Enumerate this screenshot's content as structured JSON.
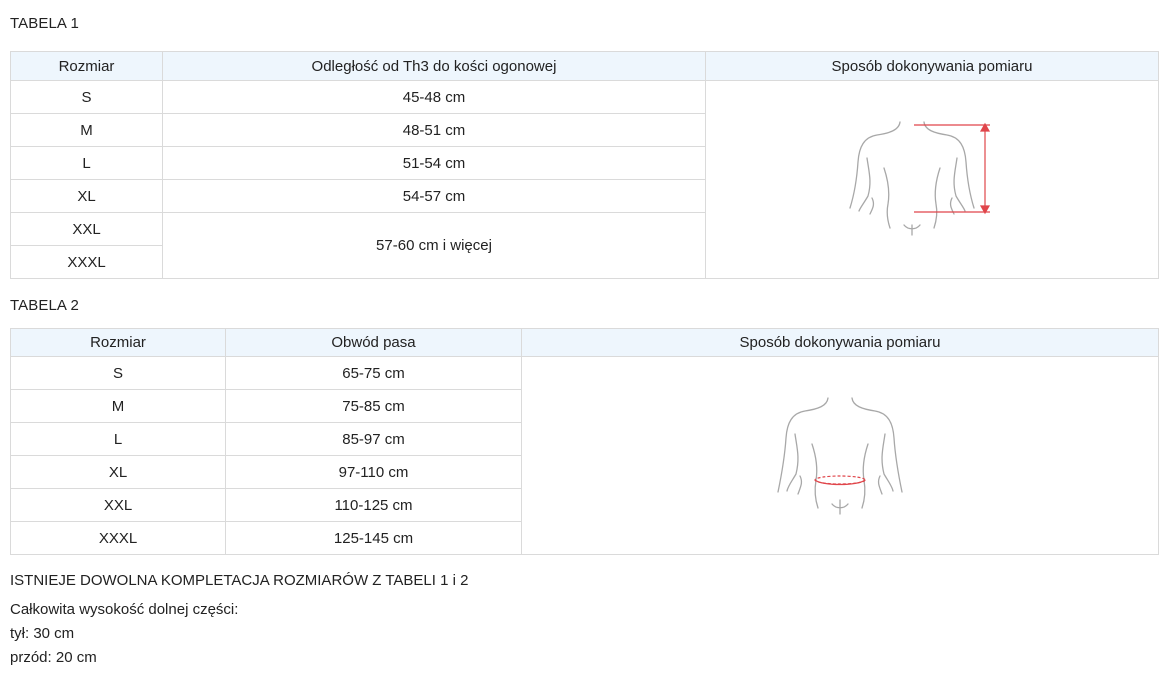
{
  "table1": {
    "caption": "TABELA 1",
    "headers": [
      "Rozmiar",
      "Odległość od Th3 do kości ogonowej",
      "Sposób dokonywania pomiaru"
    ],
    "rows": [
      {
        "size": "S",
        "value": "45-48 cm"
      },
      {
        "size": "M",
        "value": "48-51 cm"
      },
      {
        "size": "L",
        "value": "51-54 cm"
      },
      {
        "size": "XL",
        "value": "54-57 cm"
      },
      {
        "size": "XXL",
        "value": "57-60 cm i więcej"
      },
      {
        "size": "XXXL",
        "value": ""
      }
    ],
    "accent_color": "#e0454a"
  },
  "table2": {
    "caption": "TABELA 2",
    "headers": [
      "Rozmiar",
      "Obwód pasa",
      "Sposób dokonywania pomiaru"
    ],
    "rows": [
      {
        "size": "S",
        "value": "65-75 cm"
      },
      {
        "size": "M",
        "value": "75-85 cm"
      },
      {
        "size": "L",
        "value": "85-97 cm"
      },
      {
        "size": "XL",
        "value": "97-110 cm"
      },
      {
        "size": "XXL",
        "value": "110-125 cm"
      },
      {
        "size": "XXXL",
        "value": "125-145 cm"
      }
    ],
    "accent_color": "#e0454a"
  },
  "notes": {
    "combination": "ISTNIEJE DOWOLNA KOMPLETACJA ROZMIARÓW Z TABELI 1 i 2",
    "total_height_label": "Całkowita wysokość dolnej części:",
    "back": "tył: 30 cm",
    "front": "przód: 20 cm"
  },
  "colors": {
    "header_bg": "#eef6fd",
    "border": "#dadada",
    "figure_stroke": "#a8a8a8"
  }
}
